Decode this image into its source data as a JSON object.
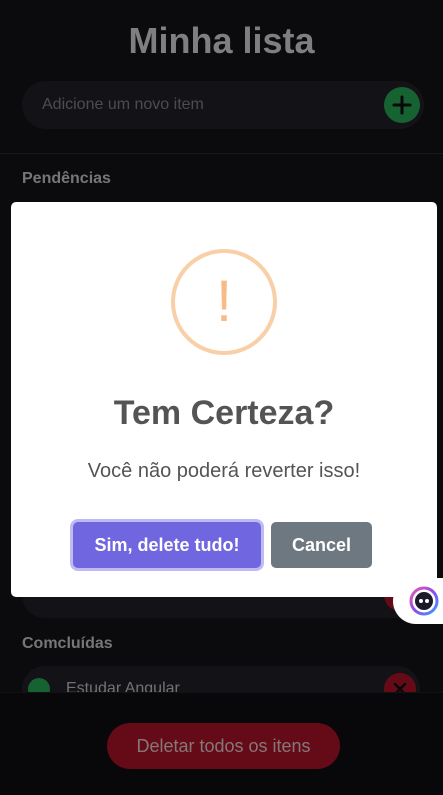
{
  "app": {
    "title": "Minha lista",
    "add_input": {
      "placeholder": "Adicione um novo item"
    },
    "sections": {
      "pending_label": "Pendências",
      "done_label": "Comcluídas"
    },
    "done_tasks": [
      {
        "text": "Estudar Angular"
      }
    ],
    "delete_all_label": "Deletar todos os itens"
  },
  "modal": {
    "icon": "!",
    "title": "Tem Certeza?",
    "text": "Você não poderá reverter isso!",
    "confirm_label": "Sim, delete tudo!",
    "cancel_label": "Cancel"
  },
  "colors": {
    "add_button": "#2bb35a",
    "delete_red": "#b8132a",
    "confirm_purple": "#7066e0",
    "cancel_gray": "#6e7881",
    "warning_orange": "#f8bb86"
  }
}
